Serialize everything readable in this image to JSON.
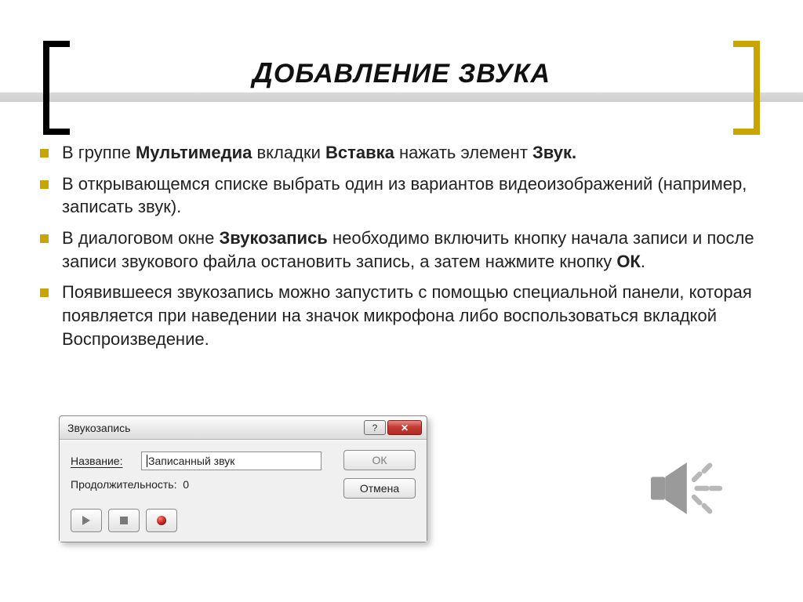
{
  "title": {
    "first": "Д",
    "rest": "ОБАВЛЕНИЕ ЗВУКА"
  },
  "bullets": [
    {
      "pre": "В группе ",
      "b1": "Мультимедиа",
      "mid1": " вкладки ",
      "b2": "Вставка",
      "mid2": " нажать элемент ",
      "b3": "Звук.",
      "post": ""
    },
    {
      "text": "В открывающемся списке выбрать один из вариантов видеоизображений (например, записать звук)."
    },
    {
      "pre": "В диалоговом окне ",
      "b1": "Звукозапись",
      "mid": " необходимо включить кнопку начала записи и после записи звукового файла остановить запись, а затем нажмите кнопку ",
      "b2": "ОК",
      "post": "."
    },
    {
      "text": "Появившееся звукозапись можно запустить с помощью специальной панели, которая появляется при наведении на значок микрофона либо воспользоваться вкладкой Воспроизведение."
    }
  ],
  "dialog": {
    "caption": "Звукозапись",
    "name_label": "Название:",
    "name_value": "Записанный звук",
    "duration_label": "Продолжительность:",
    "duration_value": "0",
    "ok": "ОК",
    "cancel": "Отмена",
    "help_symbol": "?",
    "close_symbol": "✕"
  }
}
